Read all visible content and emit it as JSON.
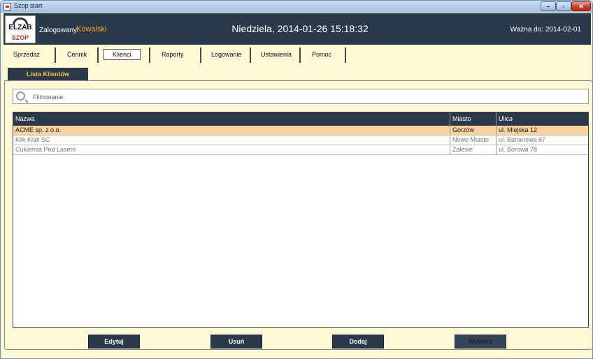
{
  "window": {
    "title": "Szop start",
    "min": "–",
    "max": "▫",
    "close": "✕"
  },
  "header": {
    "logo_text": "ELZAB",
    "logo_sub": "SZOP",
    "user_label": "Zalogowany:",
    "user_name": "Kowalski",
    "datetime": "Niedziela, 2014-01-26 15:18:32",
    "valid_until": "Ważna do: 2014-02-01"
  },
  "menu": {
    "items": [
      {
        "label": "Sprzedaż"
      },
      {
        "label": "Cennik"
      },
      {
        "label": "Klienci"
      },
      {
        "label": "Raporty"
      },
      {
        "label": "Logowanie"
      },
      {
        "label": "Ustawienia"
      },
      {
        "label": "Pomoc"
      }
    ],
    "active": "Klienci"
  },
  "panel": {
    "tab_label": "Lista Klientów"
  },
  "filter": {
    "placeholder": "Filtrowanie",
    "value": ""
  },
  "table": {
    "columns": [
      "Nazwa",
      "Miasto",
      "Ulica"
    ],
    "rows": [
      {
        "name": "ACME sp. z o.o.",
        "city": "Gorzów",
        "street": "ul. Miejska 12",
        "selected": true
      },
      {
        "name": "Klik Klak SC",
        "city": "Nowe Miasto",
        "street": "ul. Bananowa 67",
        "selected": false
      },
      {
        "name": "Cukiernia Pod Lasem",
        "city": "Zalesie",
        "street": "ul. Borowa 78",
        "selected": false
      }
    ]
  },
  "buttons": {
    "edit": "Edytuj",
    "delete": "Usuń",
    "add": "Dodaj",
    "select": "Wybierz"
  },
  "colors": {
    "header_bg": "#2b3a4b",
    "background": "#fdf8d6",
    "user_name": "#f5a623",
    "selected_row": "#fbd29f"
  },
  "icons": {
    "filter": "search-icon",
    "window_icon": "app-icon"
  }
}
